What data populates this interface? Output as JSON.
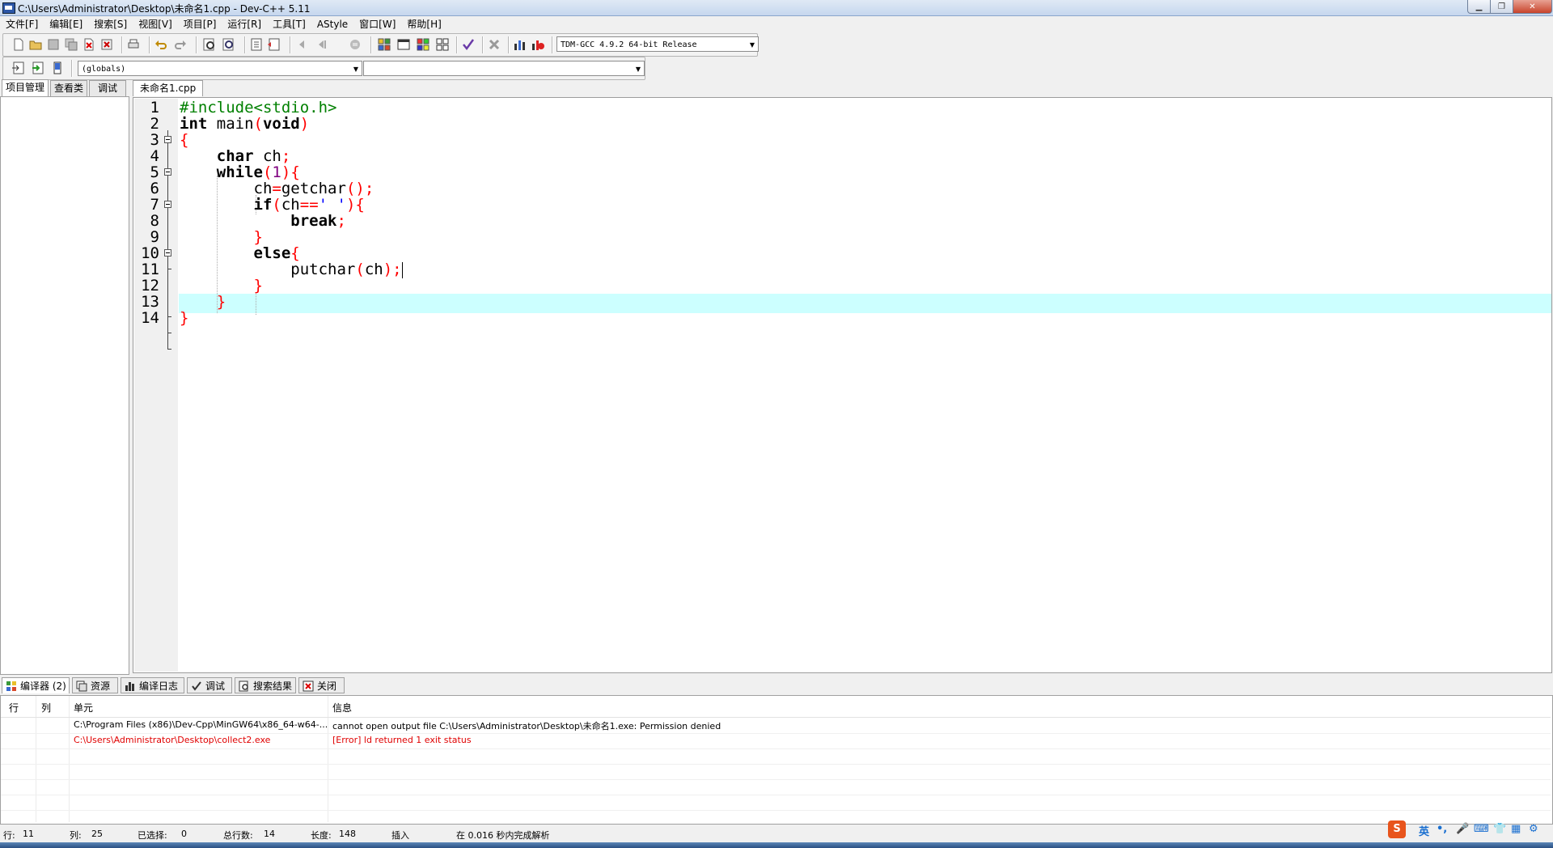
{
  "window": {
    "title": "C:\\Users\\Administrator\\Desktop\\未命名1.cpp - Dev-C++ 5.11"
  },
  "menu": [
    "文件[F]",
    "编辑[E]",
    "搜索[S]",
    "视图[V]",
    "项目[P]",
    "运行[R]",
    "工具[T]",
    "AStyle",
    "窗口[W]",
    "帮助[H]"
  ],
  "toolbar": {
    "compiler_select": "TDM-GCC 4.9.2 64-bit Release",
    "class_select": "(globals)",
    "member_select": ""
  },
  "left_tabs": [
    "项目管理",
    "查看类",
    "调试"
  ],
  "editor": {
    "tab": "未命名1.cpp",
    "lines": [
      {
        "n": "1"
      },
      {
        "n": "2"
      },
      {
        "n": "3"
      },
      {
        "n": "4"
      },
      {
        "n": "5"
      },
      {
        "n": "6"
      },
      {
        "n": "7"
      },
      {
        "n": "8"
      },
      {
        "n": "9"
      },
      {
        "n": "10"
      },
      {
        "n": "11"
      },
      {
        "n": "12"
      },
      {
        "n": "13"
      },
      {
        "n": "14"
      }
    ],
    "code": {
      "l1_pp": "#include<stdio.h>",
      "l2_type": "int",
      "l2_name": " main",
      "l2_open": "(",
      "l2_void": "void",
      "l2_close": ")",
      "l3": "{",
      "l4_type": "char",
      "l4_rest": " ch",
      "l4_semi": ";",
      "l5_kw": "while",
      "l5_open": "(",
      "l5_num": "1",
      "l5_close": "){",
      "l6_var": "ch",
      "l6_eq": "=",
      "l6_fn": "getchar",
      "l6_end": "();",
      "l7_kw": "if",
      "l7_open": "(",
      "l7_var": "ch",
      "l7_eq": "==",
      "l7_str": "' '",
      "l7_close": "){",
      "l8_kw": "break",
      "l8_semi": ";",
      "l9": "}",
      "l10_kw": "else",
      "l10_brace": "{",
      "l11_fn": "putchar",
      "l11_open": "(",
      "l11_var": "ch",
      "l11_close": ");",
      "l12": "}",
      "l13": "}",
      "l14": "}"
    }
  },
  "bottom_tabs": [
    "编译器 (2)",
    "资源",
    "编译日志",
    "调试",
    "搜索结果",
    "关闭"
  ],
  "messages": {
    "headers": [
      "行",
      "列",
      "单元",
      "信息"
    ],
    "rows": [
      {
        "unit": "C:\\Program Files (x86)\\Dev-Cpp\\MinGW64\\x86_64-w64-...",
        "info": "cannot open output file C:\\Users\\Administrator\\Desktop\\未命名1.exe: Permission denied"
      },
      {
        "unit": "C:\\Users\\Administrator\\Desktop\\collect2.exe",
        "info": "[Error] ld returned 1 exit status"
      }
    ]
  },
  "status": {
    "row_label": "行:",
    "row_value": "11",
    "col_label": "列:",
    "col_value": "25",
    "sel_label": "已选择:",
    "sel_value": "0",
    "total_label": "总行数:",
    "total_value": "14",
    "len_label": "长度:",
    "len_value": "148",
    "mode": "插入",
    "parse": "在 0.016 秒内完成解析"
  },
  "ime": {
    "lang": "英",
    "logo": "S"
  },
  "colors": {
    "highlight_line": "#ccffff",
    "error": "#e00000",
    "keyword": "#000000",
    "preprocessor": "#008000",
    "symbol": "#ff0000",
    "number": "#800080",
    "string": "#0000ff"
  }
}
